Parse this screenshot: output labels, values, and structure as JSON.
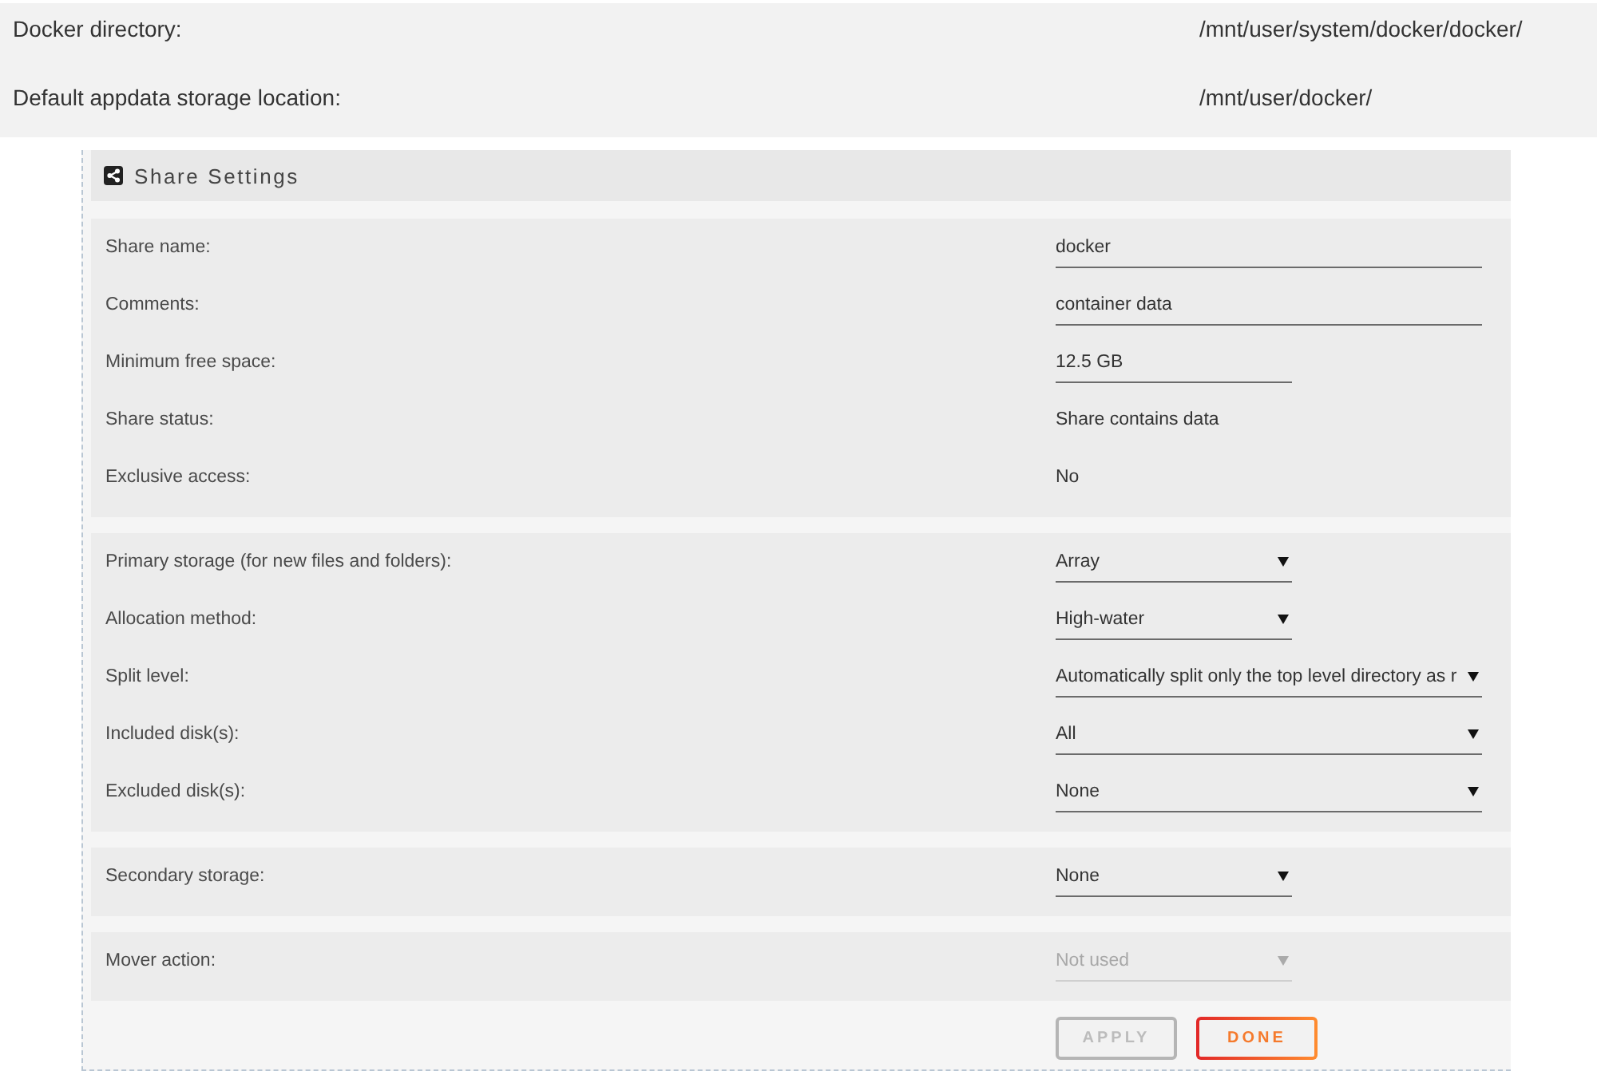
{
  "summary": [
    {
      "label": "Docker directory:",
      "value": "/mnt/user/system/docker/docker/"
    },
    {
      "label": "Default appdata storage location:",
      "value": "/mnt/user/docker/"
    }
  ],
  "share_settings": {
    "title": "Share Settings",
    "sections": [
      {
        "rows": [
          {
            "label": "Share name:",
            "kind": "field",
            "value": "docker",
            "disabled": false
          },
          {
            "label": "Comments:",
            "kind": "field",
            "value": "container data",
            "disabled": false
          },
          {
            "label": "Minimum free space:",
            "kind": "shortfield",
            "value": "12.5 GB",
            "disabled": false
          },
          {
            "label": "Share status:",
            "kind": "text",
            "value": "Share contains data",
            "disabled": false
          },
          {
            "label": "Exclusive access:",
            "kind": "text",
            "value": "No",
            "disabled": false
          }
        ]
      },
      {
        "rows": [
          {
            "label": "Primary storage (for new files and folders):",
            "kind": "select",
            "value": "Array",
            "disabled": false
          },
          {
            "label": "Allocation method:",
            "kind": "select",
            "value": "High-water",
            "disabled": false
          },
          {
            "label": "Split level:",
            "kind": "wideselect",
            "value": "Automatically split only the top level directory as r",
            "disabled": false
          },
          {
            "label": "Included disk(s):",
            "kind": "wideselect",
            "value": "All",
            "disabled": false
          },
          {
            "label": "Excluded disk(s):",
            "kind": "wideselect",
            "value": "None",
            "disabled": false
          }
        ]
      },
      {
        "rows": [
          {
            "label": "Secondary storage:",
            "kind": "select",
            "value": "None",
            "disabled": false
          }
        ]
      },
      {
        "rows": [
          {
            "label": "Mover action:",
            "kind": "select",
            "value": "Not used",
            "disabled": true
          }
        ]
      }
    ],
    "buttons": [
      {
        "label": "APPLY",
        "disabled": true
      },
      {
        "label": "DONE",
        "disabled": false
      }
    ]
  }
}
